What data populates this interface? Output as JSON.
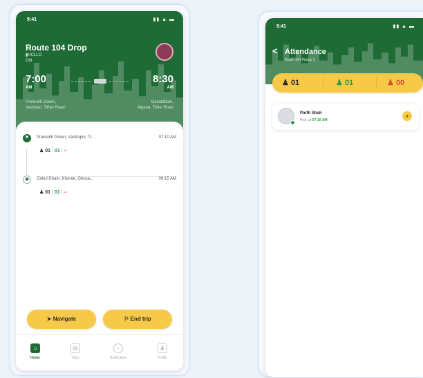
{
  "colors": {
    "primary_green": "#1f6b36",
    "accent_yellow": "#f7c948",
    "present_green": "#2e9a4a",
    "absent_red": "#e04a3a"
  },
  "trip_screen": {
    "status_time": "9:41",
    "status_icons": "▮▮ ▲ ▬",
    "route_title": "Route 104 Drop",
    "route_sub_line1": "▮HCLLO",
    "route_sub_line2": "Old",
    "start_time": "7:00",
    "start_ampm": "AM",
    "end_time": "8:30",
    "end_ampm": "AM",
    "start_place_line1": "Promukh Green,",
    "start_place_line2": "Vasthuel, Tithei Road",
    "end_place_line1": "Gokuldham,",
    "end_place_line2": "Alpana, Tithei Road",
    "stops": [
      {
        "icon": "flag-icon",
        "name": "Pramukh Green, Vastrapur, Ti...",
        "time": "07:10 AM",
        "c1": "01",
        "c2": "01",
        "c3": "--"
      },
      {
        "icon": "pin-icon",
        "name": "Gokul Dham, Khoree, Ghosa...",
        "time": "09:15 AM",
        "c1": "01",
        "c2": "01",
        "c3": "--"
      }
    ],
    "navigate_label": "Navigate",
    "end_trip_label": "End trip",
    "tabs": [
      {
        "label": "Home",
        "icon": "home-icon",
        "active": true
      },
      {
        "label": "Trips",
        "icon": "trips-icon",
        "active": false
      },
      {
        "label": "Notification",
        "icon": "bell-icon",
        "active": false
      },
      {
        "label": "Profile",
        "icon": "profile-icon",
        "active": false
      }
    ]
  },
  "attendance_screen": {
    "status_time": "9:41",
    "status_icons": "▮▮ ▲ ▬",
    "back_glyph": "<",
    "title": "Attendance",
    "subtitle": "Route 104 Pickup 1",
    "stats": [
      {
        "icon": "students-icon",
        "value": "01",
        "color": "#2b2b2b"
      },
      {
        "icon": "present-icon",
        "value": "01",
        "color": "#2e9a4a"
      },
      {
        "icon": "absent-icon",
        "value": "00",
        "color": "#e04a3a"
      }
    ],
    "student": {
      "name": "Parth Shah",
      "pick_prefix": "Pick up",
      "pick_time": "07:10 AM"
    }
  }
}
